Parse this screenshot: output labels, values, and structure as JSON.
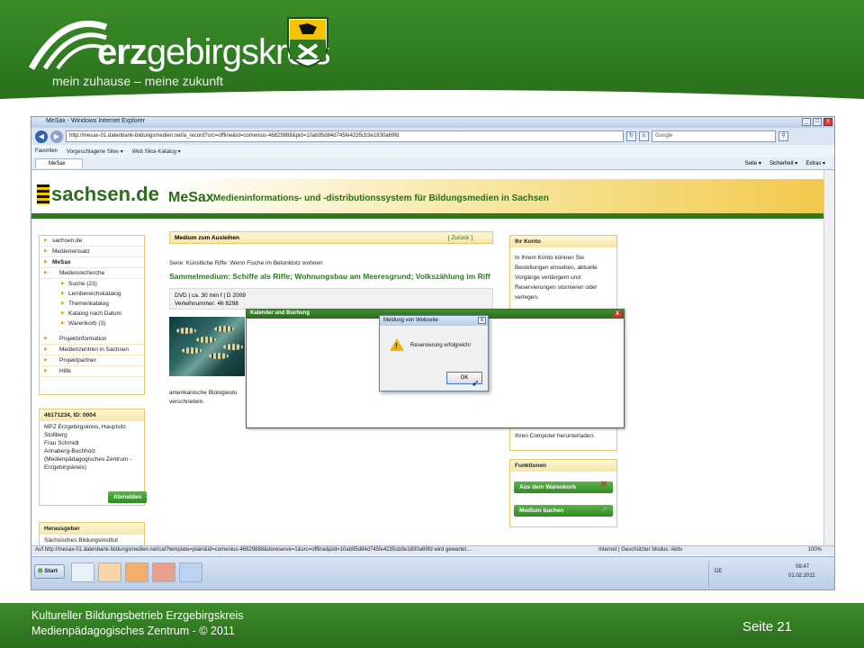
{
  "slide": {
    "brand_bold": "erz",
    "brand_rest": "gebirgskreis",
    "slogan": "mein zuhause – meine zukunft",
    "footer_line1": "Kultureller Bildungsbetrieb Erzgebirgskreis",
    "footer_line2": "Medienpädagogisches Zentrum  -  © 2011",
    "page_number": "Seite 21"
  },
  "browser": {
    "window_title": "MeSax - Windows Internet Explorer",
    "address": "http://mesax-01.datenbank-bildungsmedien.net/a_record?src=offline&id=comenius-46829888&pid=10ab95d84d745fe4235cb3e1830a69fd",
    "search_placeholder": "Google",
    "favorites": "Favoriten",
    "suggested_sites": "Vorgeschlagene Sites ▾",
    "web_slice": "Web Slice-Katalog ▾",
    "tab_label": "MeSax",
    "cmd_page": "Seite ▾",
    "cmd_security": "Sicherheit ▾",
    "cmd_extras": "Extras ▾",
    "status_url": "Auf http://mesax-01.datenbank-bildungsmedien.net/cal?template=plain&id=comenius-46829888&doreserve=1&src=offline&pid=10ab95d84d745fe4235cb3e1830a69fd wird gewartet....",
    "status_zone": "Internet | Geschützter Modus: Aktiv",
    "zoom": "100%"
  },
  "mesax": {
    "site_logo": "sachsen.de",
    "app_name": "MeSax",
    "app_subtitle": "Medieninformations- und -distributionssystem für Bildungsmedien in Sachsen",
    "breadcrumb": [
      "sachsen.de",
      "Medieneinsatz"
    ],
    "nav_section": "MeSax",
    "nav_recherche": "Medienrecherche",
    "nav_sub": [
      "Suche (23)",
      "Lernbereichskatalog",
      "Themenkatalog",
      "Katalog nach Datum",
      "Warenkorb (3)"
    ],
    "nav_more": [
      "Projektinformation",
      "Medienzentren in Sachsen",
      "Projektpartner",
      "Hilfe"
    ],
    "user_box_title": "46171234, ID: 0004",
    "user_box_lines": [
      "MPZ Erzgebirgskreis, Hauptsitz",
      "Stollberg",
      "Frau Schmidt",
      "Annaberg-Buchholz",
      "(Medienpädagogisches Zentrum -",
      "Erzgebirgskreis)"
    ],
    "logout": "Abmelden",
    "publisher_title": "Herausgeber",
    "publisher_item": "Sächsisches Bildungsinstitut",
    "main_head": "Medium zum Ausleihen",
    "back": "[ Zurück ]",
    "series": "Serie: Künstliche Riffe: Wenn Fische im Betonklotz wohnen",
    "medium_title": "Sammelmedium: Schiffe als Riffe; Wohnungsbau am Meeresgrund; Volkszählung im Riff",
    "info_line1": "DVD | ca. 30 min f | D 2009",
    "info_line2": "Verleihnummer: 46 8298",
    "desc_line1": "amerikanische Biologiestu",
    "desc_line2": "verschrieben.",
    "konto_title": "Ihr Konto",
    "konto_text": [
      "In Ihrem Konto können Sie",
      "Bestellungen einsehen, aktuelle",
      "Vorgänge verlängern und",
      "Reservierungen stornieren oder",
      "verlegen."
    ],
    "konto_tail": "Ihren Computer herunterladen.",
    "funktionen_title": "Funktionen",
    "btn_remove": "Aus dem Warenkorb",
    "btn_book": "Medium buchen"
  },
  "dialogs": {
    "calendar_title": "Kalender und Buchung",
    "calendar_close": "X",
    "msg_title": "Meldung von Webseite",
    "msg_text": "Reservierung erfolgreich!",
    "ok": "OK"
  },
  "taskbar": {
    "start": "Start",
    "lang": "DE",
    "time": "08:47",
    "date": "01.02.2011"
  }
}
